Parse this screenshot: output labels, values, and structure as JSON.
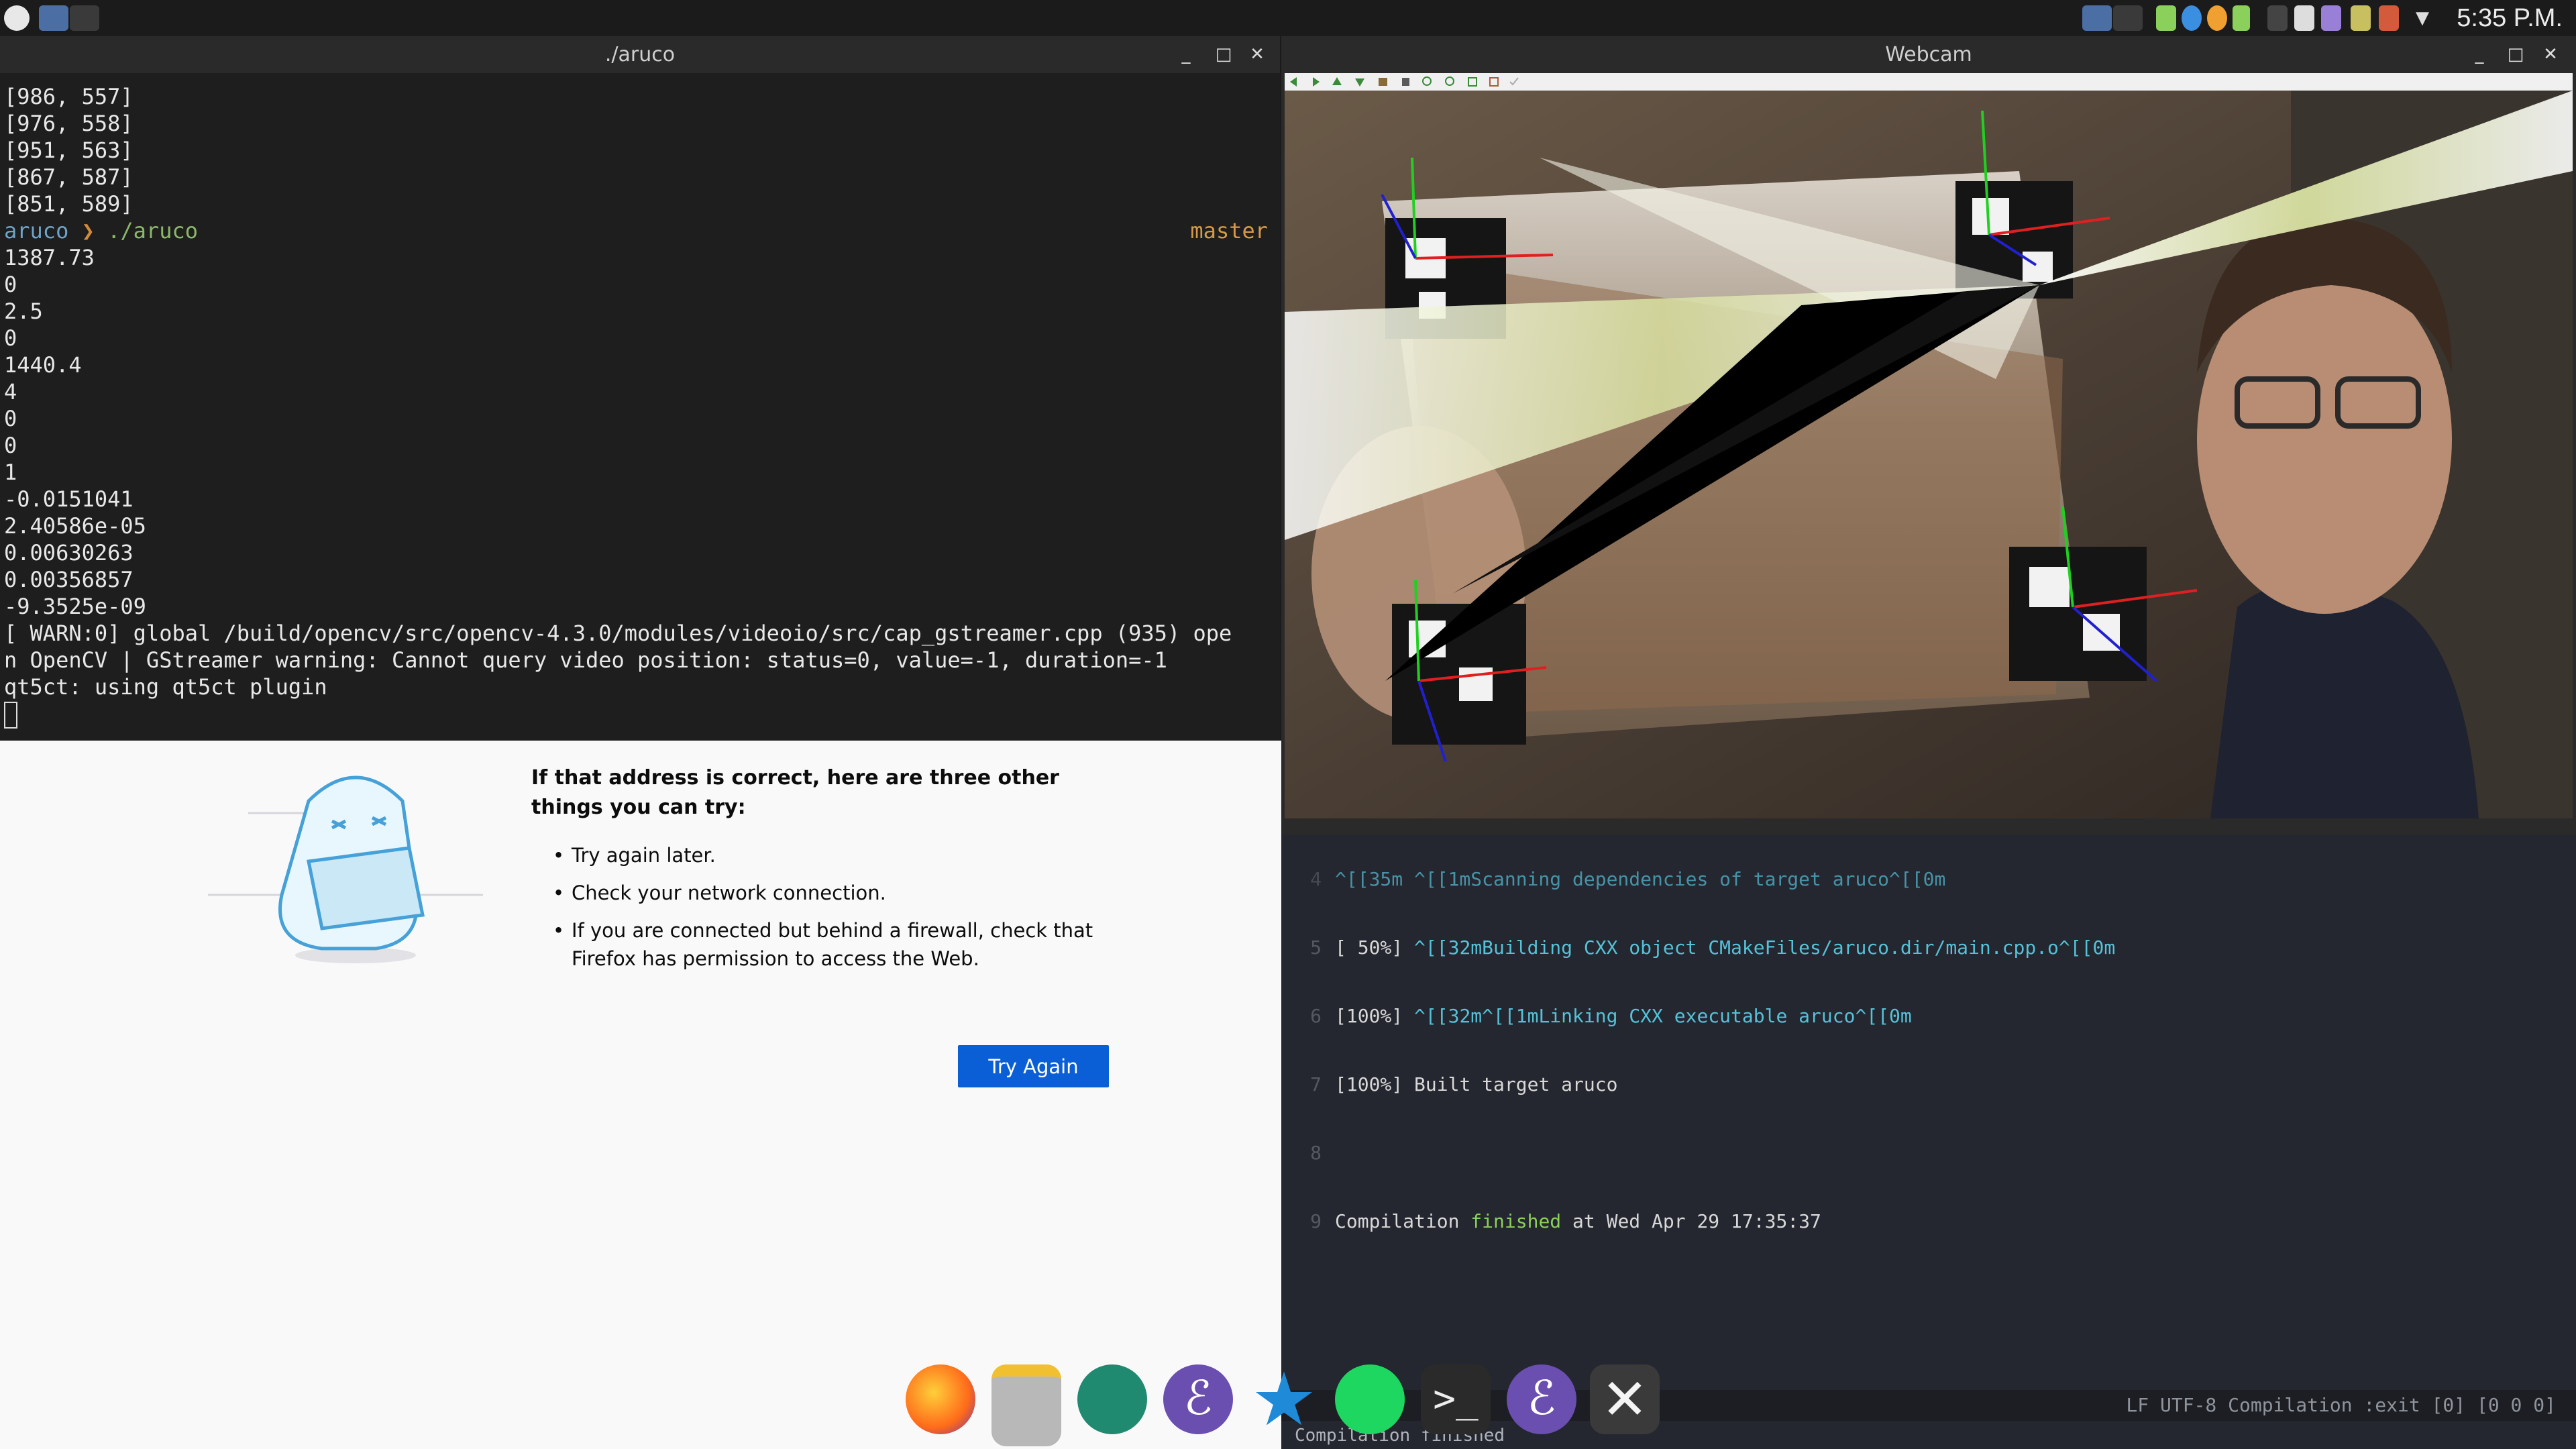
{
  "topbar": {
    "clock": "5:35 P.M."
  },
  "terminal": {
    "title": "./aruco",
    "controls": {
      "minimize": "_",
      "maximize": "□",
      "close": "✕"
    },
    "lines_top": [
      "[986, 557]",
      "[976, 558]",
      "[951, 563]",
      "[867, 587]",
      "[851, 589]"
    ],
    "prompt_dir": "aruco",
    "prompt_arrow": "❯",
    "prompt_cmd": "./aruco",
    "branch": "master",
    "lines_output": [
      "1387.73",
      "0",
      "2.5",
      "0",
      "1440.4",
      "4",
      "0",
      "0",
      "1",
      "-0.0151041",
      "2.40586e-05",
      "0.00630263",
      "0.00356857",
      "-9.3525e-09",
      "[ WARN:0] global /build/opencv/src/opencv-4.3.0/modules/videoio/src/cap_gstreamer.cpp (935) ope",
      "n OpenCV | GStreamer warning: Cannot query video position: status=0, value=-1, duration=-1",
      "qt5ct: using qt5ct plugin"
    ]
  },
  "firefox": {
    "heading": "If that address is correct, here are three other things you can try:",
    "tips": [
      "Try again later.",
      "Check your network connection.",
      "If you are connected but behind a firewall, check that Firefox has permission to access the Web."
    ],
    "try_again_label": "Try Again"
  },
  "webcam": {
    "title": "Webcam",
    "controls": {
      "minimize": "_",
      "maximize": "□",
      "close": "✕"
    }
  },
  "emacs": {
    "lines": [
      {
        "n": "4",
        "text": "^[[35m ^[[1mScanning dependencies of target aruco^[[0m",
        "partial": true
      },
      {
        "n": "5",
        "pct": "[ 50%]",
        "cyan": "^[[32mBuilding CXX object CMakeFiles/aruco.dir/main.cpp.o^[[0m"
      },
      {
        "n": "6",
        "pct": "[100%]",
        "cyan": "^[[32m^[[1mLinking CXX executable aruco^[[0m"
      },
      {
        "n": "7",
        "pct": "[100%]",
        "text": "Built target aruco"
      },
      {
        "n": "8",
        "text": ""
      },
      {
        "n": "9",
        "pre": "Compilation ",
        "green": "finished",
        "post": " at Wed Apr 29 17:35:37"
      }
    ],
    "modeline_right": "LF UTF-8  Compilation :exit [0] [0 0 0]",
    "echo": "Compilation finished"
  },
  "dock": {
    "items": [
      "firefox-icon",
      "files-icon",
      "settings-icon",
      "emacs-icon",
      "kstars-icon",
      "spotify-icon",
      "terminal-icon",
      "emacs-icon",
      "xorg-icon"
    ]
  },
  "colors": {
    "accent": "#0a5fd6",
    "terminal_bg": "#1e1e1e",
    "emacs_bg": "#242730"
  }
}
